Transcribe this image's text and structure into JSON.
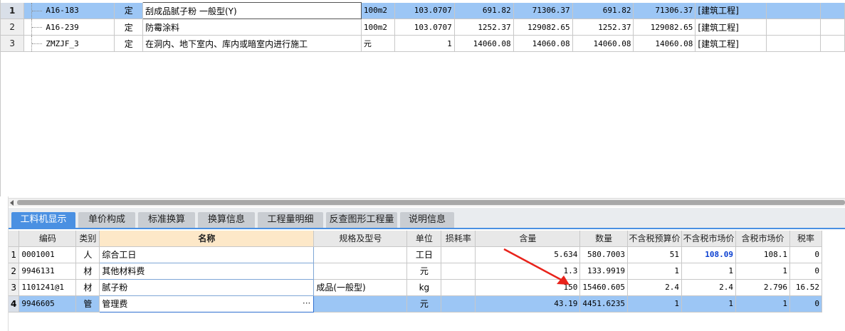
{
  "colors": {
    "selected_row": "#9cc6f5",
    "tab_active": "#4a90e2",
    "highlight_value": "#0a3fd0",
    "arrow": "#e8231b"
  },
  "upper_grid": {
    "rows": [
      {
        "num": "1",
        "code": "A16-183",
        "type": "定",
        "name": "刮成品腻子粉 一般型(Y)",
        "unit": "100m2",
        "qty": "103.0707",
        "price": "691.82",
        "total": "71306.37",
        "price2": "691.82",
        "total2": "71306.37",
        "category": "[建筑工程]"
      },
      {
        "num": "2",
        "code": "A16-239",
        "type": "定",
        "name": "防霉涂料",
        "unit": "100m2",
        "qty": "103.0707",
        "price": "1252.37",
        "total": "129082.65",
        "price2": "1252.37",
        "total2": "129082.65",
        "category": "[建筑工程]"
      },
      {
        "num": "3",
        "code": "ZMZJF_3",
        "type": "定",
        "name": "在洞内、地下室内、库内或暗室内进行施工",
        "unit": "元",
        "qty": "1",
        "price": "14060.08",
        "total": "14060.08",
        "price2": "14060.08",
        "total2": "14060.08",
        "category": "[建筑工程]"
      }
    ]
  },
  "tabs": [
    {
      "label": "工料机显示"
    },
    {
      "label": "单价构成"
    },
    {
      "label": "标准换算"
    },
    {
      "label": "换算信息"
    },
    {
      "label": "工程量明细"
    },
    {
      "label": "反查图形工程量"
    },
    {
      "label": "说明信息"
    }
  ],
  "lower_grid": {
    "headers": {
      "code": "编码",
      "category": "类别",
      "name": "名称",
      "spec": "规格及型号",
      "unit": "单位",
      "loss": "损耗率",
      "content": "含量",
      "quantity": "数量",
      "budget_price": "不含税预算价",
      "market_price": "不含税市场价",
      "tax_market_price": "含税市场价",
      "tax_rate": "税率"
    },
    "rows": [
      {
        "num": "1",
        "code": "0001001",
        "category": "人",
        "name": "综合工日",
        "spec": "",
        "unit": "工日",
        "loss": "",
        "content": "5.634",
        "quantity": "580.7003",
        "budget_price": "51",
        "market_price": "108.09",
        "tax_market_price": "108.1",
        "tax_rate": "0"
      },
      {
        "num": "2",
        "code": "9946131",
        "category": "材",
        "name": "其他材料费",
        "spec": "",
        "unit": "元",
        "loss": "",
        "content": "1.3",
        "quantity": "133.9919",
        "budget_price": "1",
        "market_price": "1",
        "tax_market_price": "1",
        "tax_rate": "0"
      },
      {
        "num": "3",
        "code": "1101241@1",
        "category": "材",
        "name": "腻子粉",
        "spec": "成品(一般型)",
        "unit": "kg",
        "loss": "",
        "content": "150",
        "quantity": "15460.605",
        "budget_price": "2.4",
        "market_price": "2.4",
        "tax_market_price": "2.796",
        "tax_rate": "16.52"
      },
      {
        "num": "4",
        "code": "9946605",
        "category": "管",
        "name": "管理费",
        "spec": "",
        "unit": "元",
        "loss": "",
        "content": "43.19",
        "quantity": "4451.6235",
        "budget_price": "1",
        "market_price": "1",
        "tax_market_price": "1",
        "tax_rate": "0"
      }
    ],
    "ellipsis": "···"
  }
}
